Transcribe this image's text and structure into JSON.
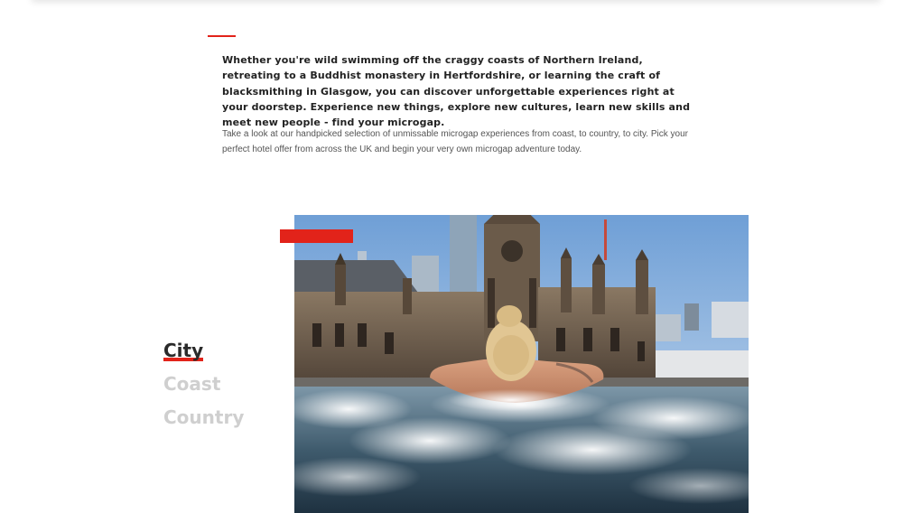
{
  "intro": {
    "bold_text": "Whether you're wild swimming off the craggy coasts of Northern Ireland, retreating to a Buddhist monastery in Hertfordshire, or learning the craft of blacksmithing in Glasgow, you can discover unforgettable experiences right at your doorstep. Experience new things, explore new cultures, learn new skills and meet new people - find your microgap.",
    "body_text": "Take a look at our handpicked selection of unmissable microgap experiences from coast, to country, to city. Pick your perfect hotel offer from across the UK and begin your very own microgap adventure today."
  },
  "categories": [
    {
      "label": "City",
      "active": true
    },
    {
      "label": "Coast",
      "active": false
    },
    {
      "label": "Country",
      "active": false
    }
  ],
  "colors": {
    "accent": "#e2231a",
    "text_dark": "#222222",
    "text_muted": "#555555",
    "inactive_tab": "#cfcfcf"
  },
  "photo": {
    "icon": "rooftop-hot-tub-photo"
  }
}
